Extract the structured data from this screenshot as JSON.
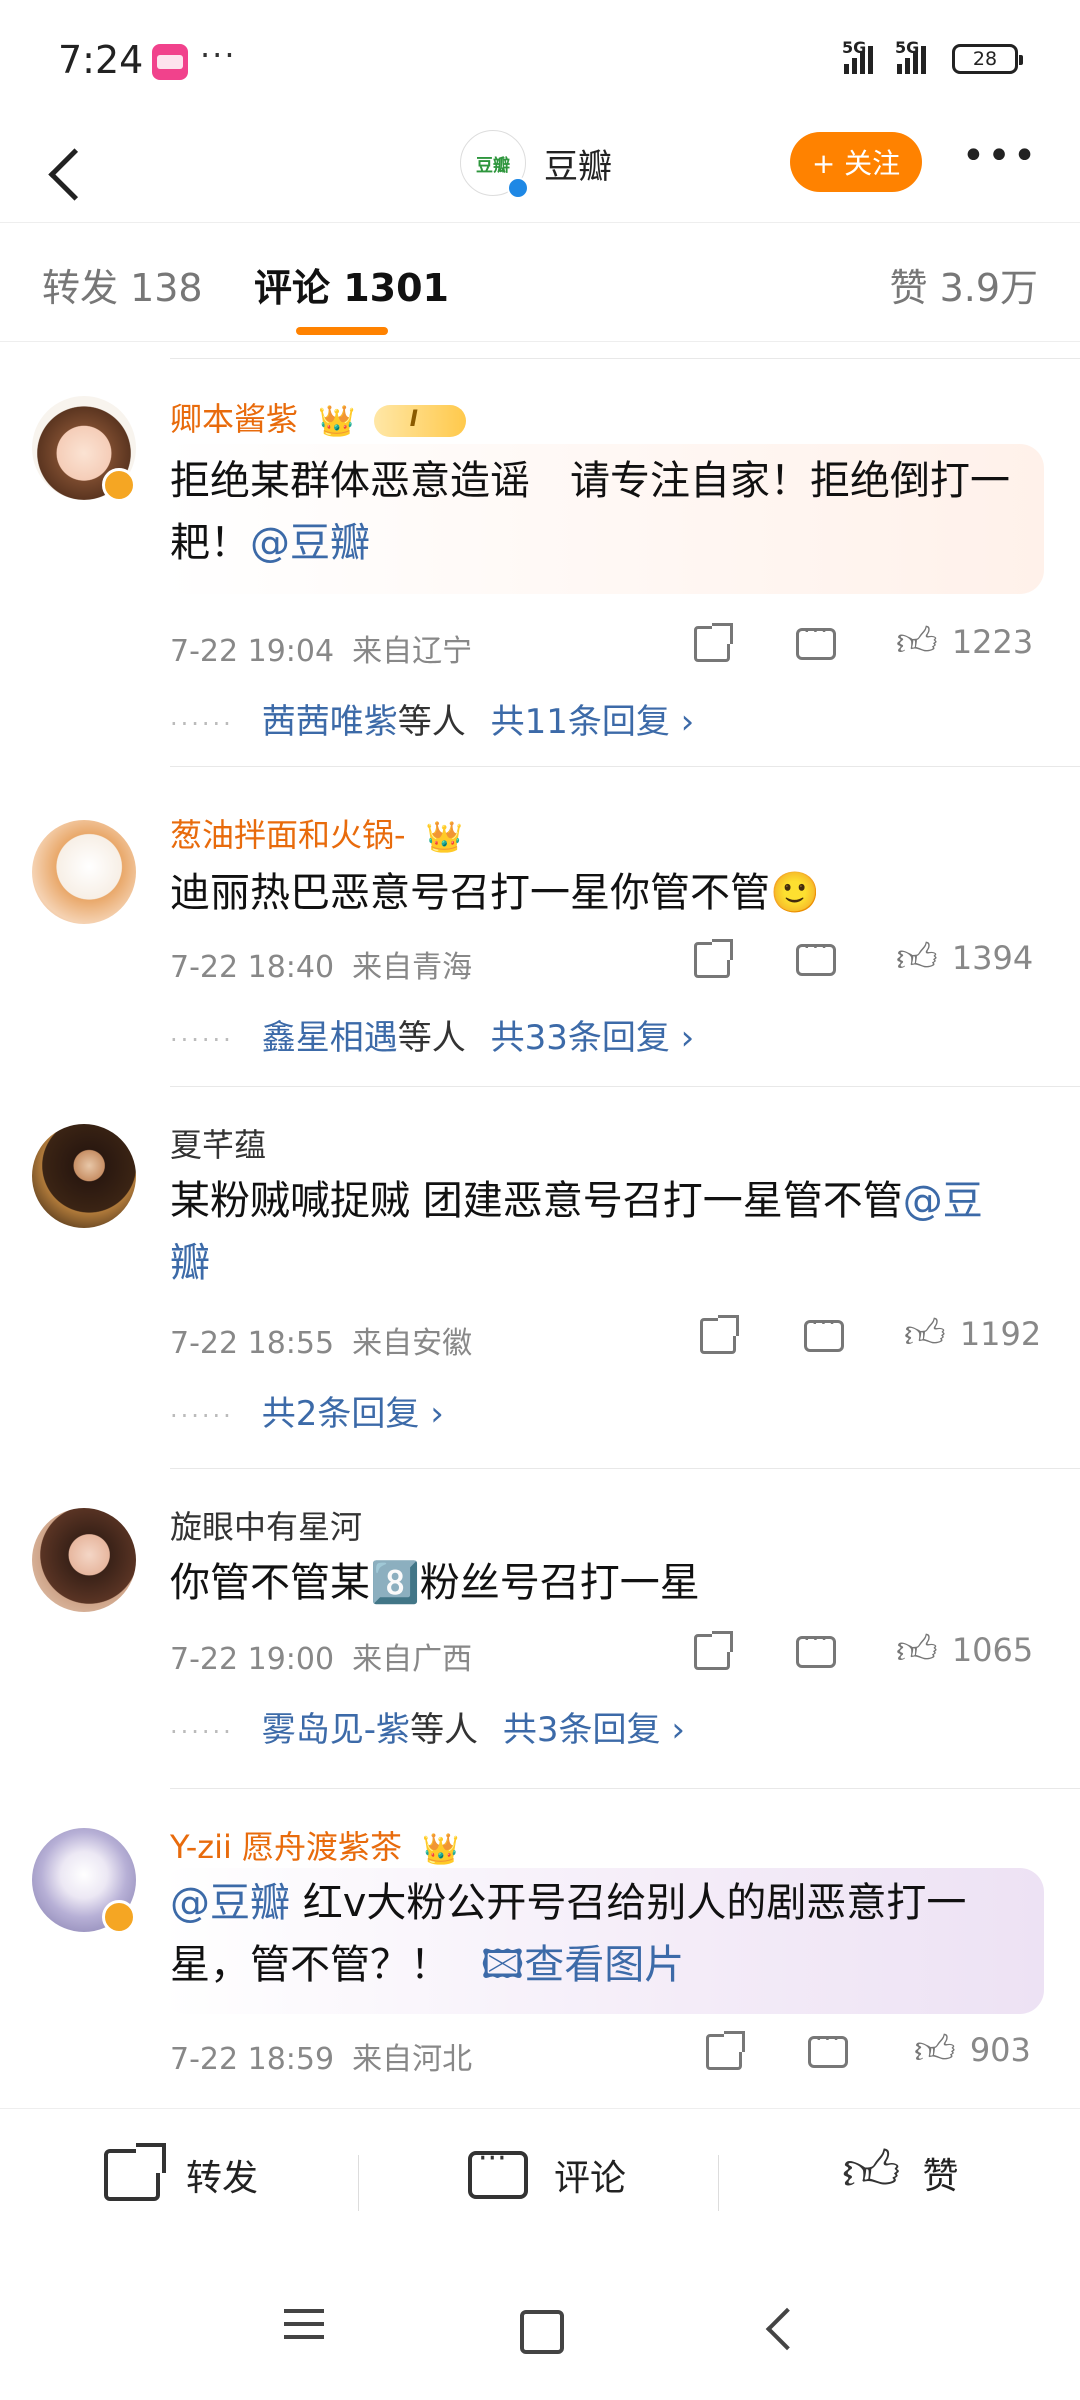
{
  "status_bar": {
    "time": "7:24",
    "dots": "···",
    "net1": "5G",
    "net2": "5G",
    "battery": "28"
  },
  "header": {
    "account_name": "豆瓣",
    "avatar_text": "豆瓣",
    "follow_label": "+ 关注",
    "more": "•••"
  },
  "tabs": {
    "repost": "转发 138",
    "comments": "评论 1301",
    "likes": "赞 3.9万"
  },
  "comments": [
    {
      "name": "卿本酱紫",
      "level": "I",
      "text": "拒绝某群体恶意造谣　请专注自家！拒绝倒打一耙！",
      "mention": "@豆瓣",
      "time": "7-22 19:04",
      "location": "来自辽宁",
      "likes": "1223",
      "reply_users": "茜茜唯紫",
      "reply_suffix": "等人",
      "reply_count": "共11条回复 ›"
    },
    {
      "name": "葱油拌面和火锅-",
      "text": "迪丽热巴恶意号召打一星你管不管🙂",
      "time": "7-22 18:40",
      "location": "来自青海",
      "likes": "1394",
      "reply_users": "鑫星相遇",
      "reply_suffix": "等人",
      "reply_count": "共33条回复 ›"
    },
    {
      "name": "夏芊蕴",
      "text": "某粉贼喊捉贼 团建恶意号召打一星管不管",
      "mention": "@豆瓣",
      "time": "7-22 18:55",
      "location": "来自安徽",
      "likes": "1192",
      "reply_count": "共2条回复 ›"
    },
    {
      "name": "旋眼中有星河",
      "text": "你管不管某8️⃣粉丝号召打一星",
      "time": "7-22 19:00",
      "location": "来自广西",
      "likes": "1065",
      "reply_users": "雾岛见-紫",
      "reply_suffix": "等人",
      "reply_count": "共3条回复 ›"
    },
    {
      "name": "Y-zii 愿舟渡紫茶",
      "mention": "@豆瓣",
      "text": " 红v大粉公开号召给别人的剧恶意打一星，管不管？！",
      "image_link": "🖾查看图片",
      "time": "7-22 18:59",
      "location": "来自河北",
      "likes": "903"
    }
  ],
  "bottom_bar": {
    "repost": "转发",
    "comment": "评论",
    "like": "赞"
  },
  "colors": {
    "accent": "#ff8200",
    "link": "#3c6aa8",
    "vip_name": "#e86b0c"
  },
  "icons": [
    "back-icon",
    "more-icon",
    "share-icon",
    "comment-icon",
    "like-icon",
    "menu-icon",
    "home-icon",
    "nav-back-icon"
  ]
}
